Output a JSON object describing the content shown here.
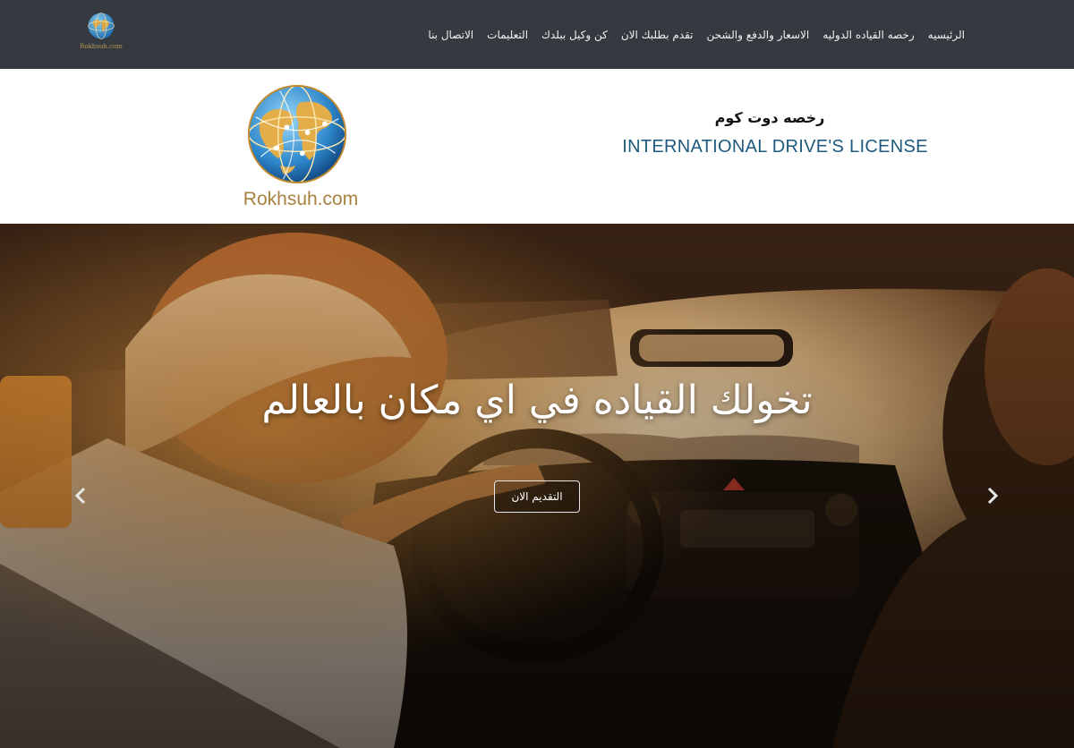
{
  "nav": {
    "items": [
      {
        "label": "الرئيسيه"
      },
      {
        "label": "رخصه القياده الدوليه"
      },
      {
        "label": "الاسعار والدفع والشحن"
      },
      {
        "label": "تقدم بطلبك الان"
      },
      {
        "label": "كن وكيل ببلدك"
      },
      {
        "label": "التعليمات"
      },
      {
        "label": "الاتصال بنا"
      }
    ],
    "logo_caption": "Rokhsuh.com"
  },
  "brand": {
    "arabic_title": "رخصه دوت كوم",
    "english_title": "INTERNATIONAL DRIVE'S LICENSE",
    "logo_text": "Rokhsuh.com"
  },
  "hero": {
    "headline": "تخولك القياده في اي مكان بالعالم",
    "cta_label": "التقديم الان",
    "prev_icon": "chevron-left-icon",
    "next_icon": "chevron-right-icon"
  },
  "colors": {
    "topbar": "#343a40",
    "brand_blue": "#1f5a7e",
    "logo_gold": "#a6813f"
  }
}
